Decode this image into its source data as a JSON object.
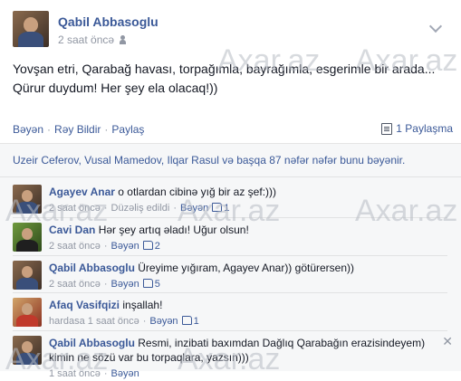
{
  "post": {
    "author": "Qabil Abbasoglu",
    "time": "2 saat öncə",
    "text_line1": "Yovşan etri, Qarabağ havası, torpağımla, bayrağımla, esgerimle bir arada...",
    "text_line2": "Qürur duydum! Her şey ela olacaq!))"
  },
  "actions": {
    "like": "Bəyən",
    "comment": "Rəy Bildir",
    "share": "Paylaş",
    "share_count": "1 Paylaşma"
  },
  "likes_text": "Uzeir Ceferov, Vusal Mamedov, Ilqar Rasul və başqa 87 nəfər nəfər bunu bəyənir.",
  "watermarks": [
    "Axar.az",
    "Axar.az",
    "Axar.az",
    "Axar.az",
    "Axar.az",
    "Axar.az",
    "Axar.az"
  ],
  "comments": [
    {
      "name": "Agayev Anar",
      "text": "o otlardan cibinə yığ bir az şef:)))",
      "time": "2 saat öncə",
      "extra": "Düzəliş edildi",
      "like": "Bəyən",
      "count": "1"
    },
    {
      "name": "Cavi Dan",
      "text": "Hər şey artıq əladı! Uğur olsun!",
      "time": "2 saat öncə",
      "like": "Bəyən",
      "count": "2"
    },
    {
      "name": "Qabil Abbasoglu",
      "text": "Üreyime yığıram, Agayev Anar)) götürersen))",
      "time": "2 saat öncə",
      "like": "Bəyən",
      "count": "5"
    },
    {
      "name": "Afaq Vasifqizi",
      "text": "inşallah!",
      "time": "hardasa 1 saat öncə",
      "like": "Bəyən",
      "count": "1"
    },
    {
      "name": "Qabil Abbasoglu",
      "text": "Resmi, inzibati baxımdan Dağlıq Qarabağın erazisindeyem)",
      "text2": "kimin ne sözü var bu torpaqlara, yazsın)))",
      "time": "1 saat öncə",
      "like": "Bəyən"
    }
  ]
}
